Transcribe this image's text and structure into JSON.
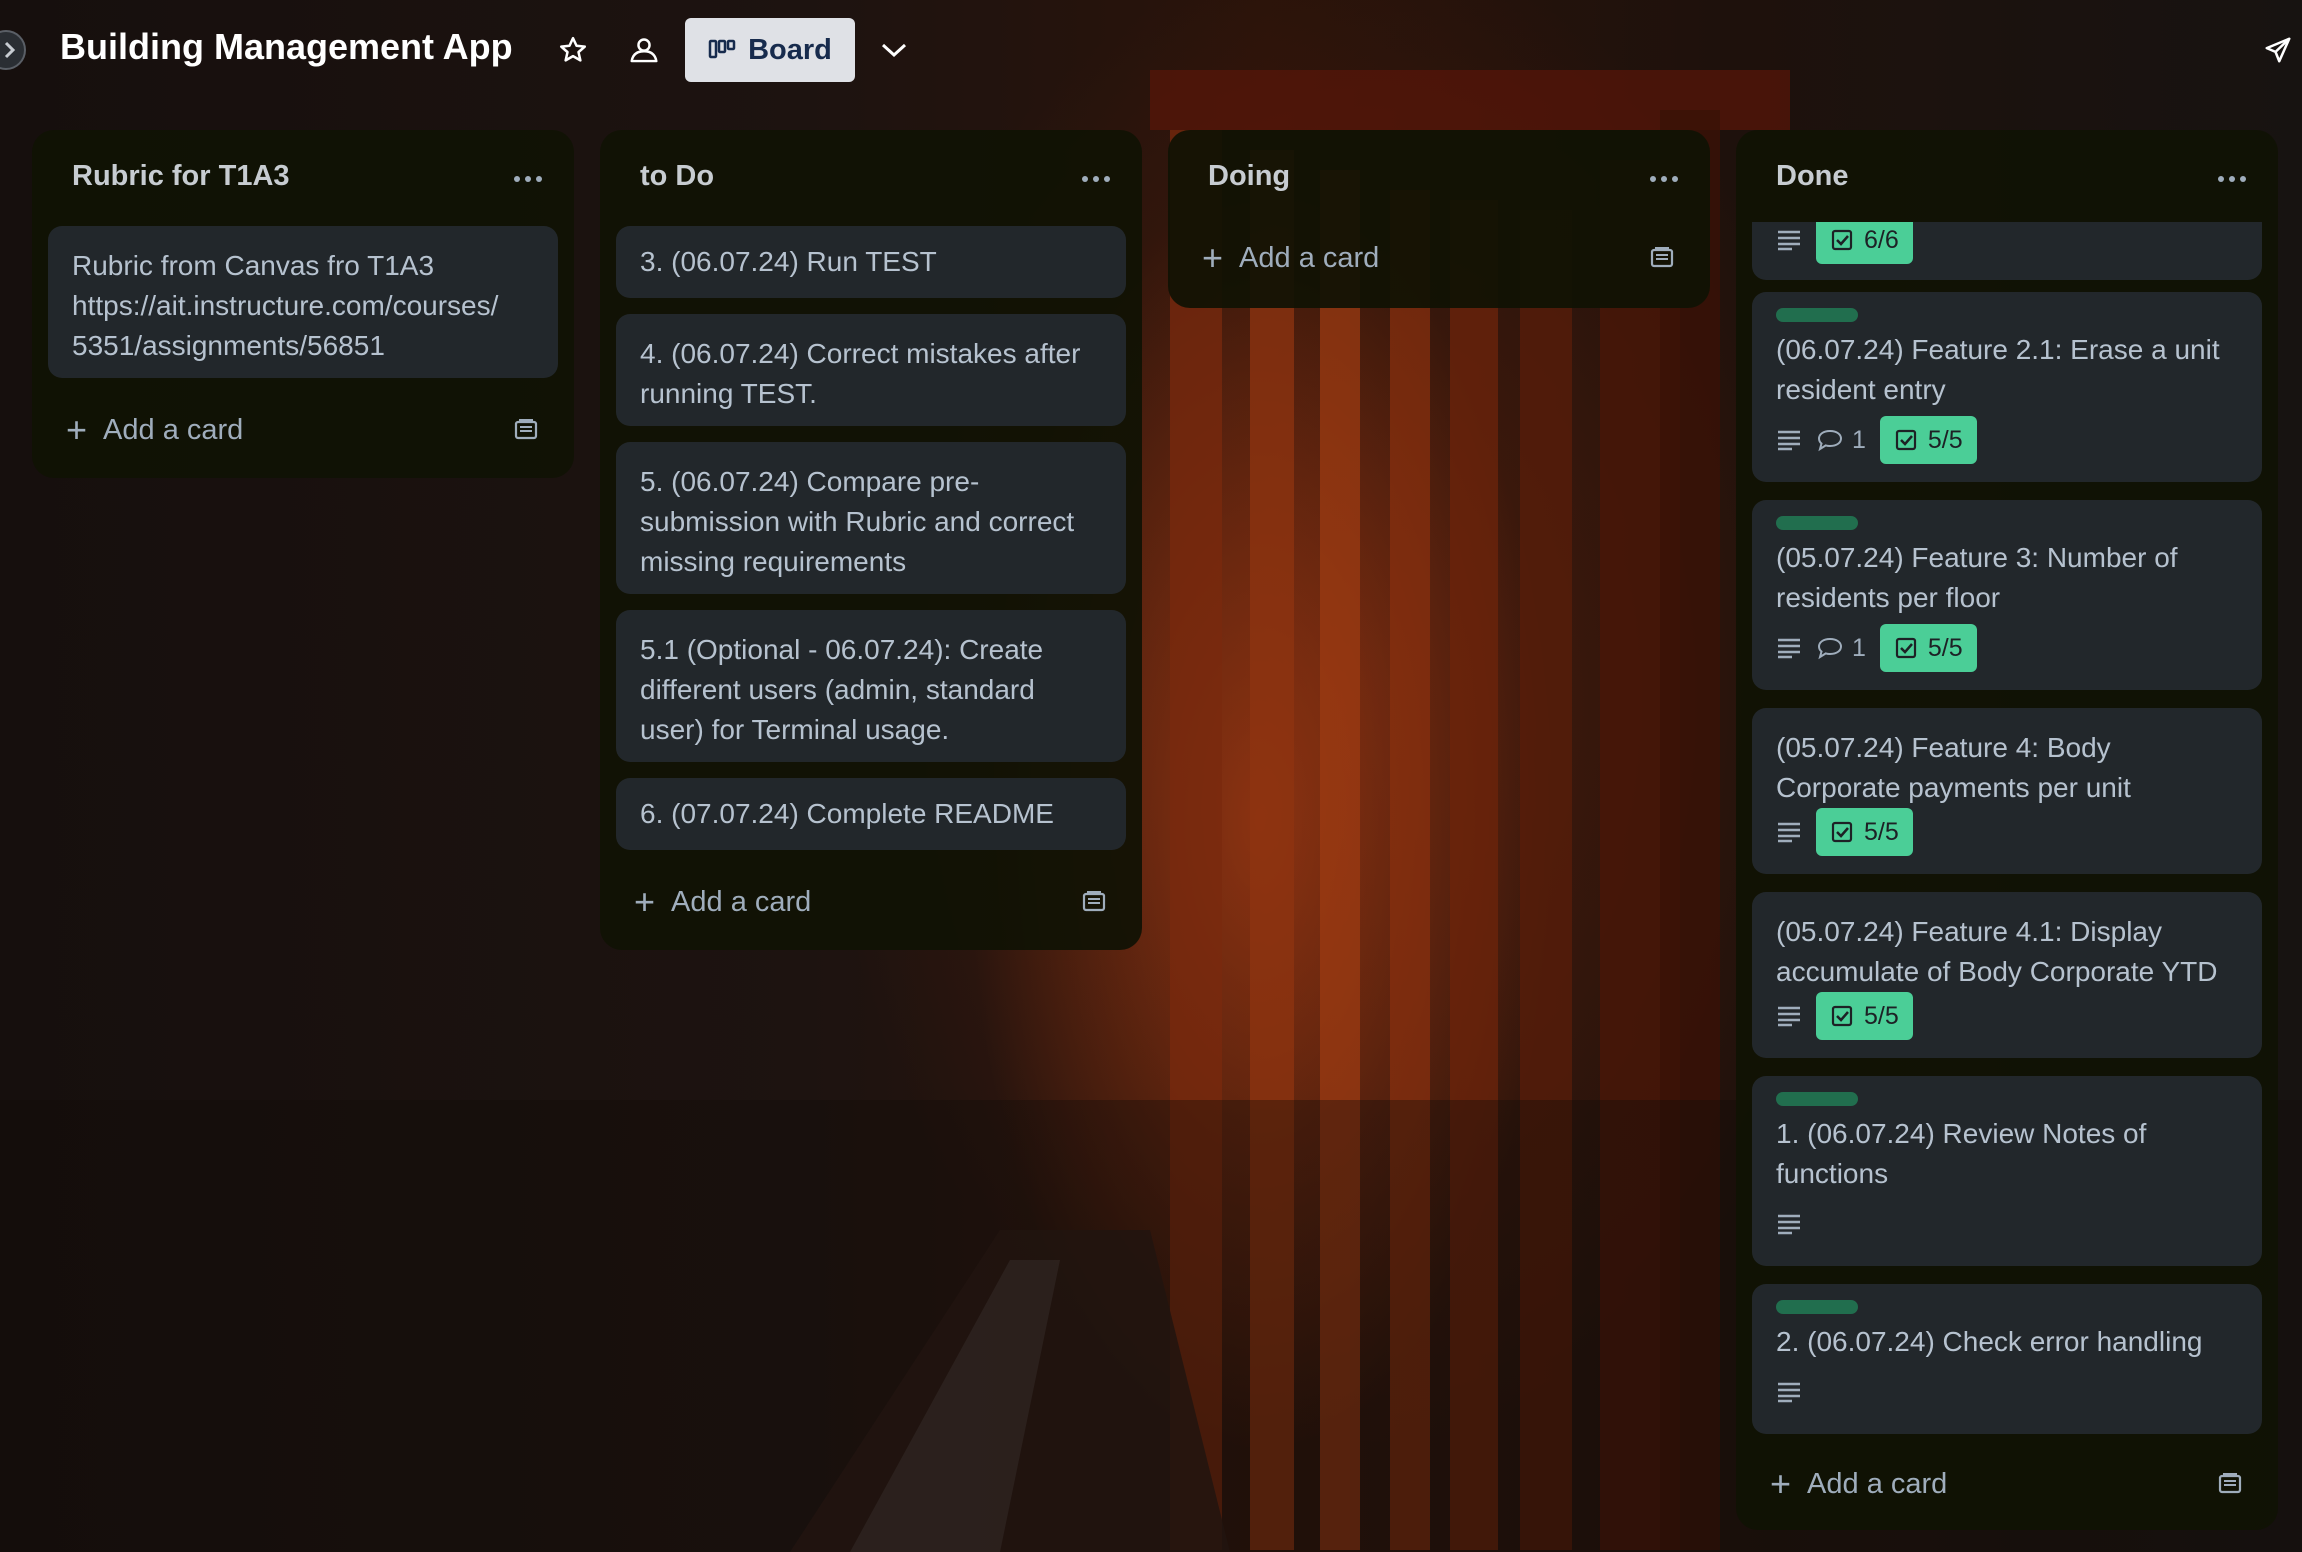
{
  "board": {
    "title": "Building Management App",
    "view_label": "Board"
  },
  "header_icons": [
    "chevron-right-icon",
    "star-icon",
    "team-visibility-icon",
    "board-icon",
    "chevron-down-icon",
    "power-up-rocket-icon"
  ],
  "lists": {
    "rubric": {
      "name": "Rubric for T1A3",
      "cards": [
        {
          "lines": [
            "Rubric from Canvas fro T1A3",
            "https://ait.instructure.com/courses/",
            "5351/assignments/56851"
          ]
        }
      ],
      "add_card": "Add a card"
    },
    "todo": {
      "name": "to Do",
      "cards": [
        {
          "lines": [
            "3. (06.07.24) Run TEST"
          ]
        },
        {
          "lines": [
            "4. (06.07.24) Correct mistakes after",
            "running TEST."
          ]
        },
        {
          "lines": [
            "5. (06.07.24) Compare pre-",
            "submission with Rubric and correct",
            "missing requirements"
          ]
        },
        {
          "lines": [
            "5.1 (Optional - 06.07.24): Create",
            "different users (admin, standard",
            "user) for Terminal usage."
          ]
        },
        {
          "lines": [
            "6. (07.07.24) Complete README"
          ]
        }
      ],
      "add_card": "Add a card"
    },
    "doing": {
      "name": "Doing",
      "add_card": "Add a card"
    },
    "done": {
      "name": "Done",
      "cards": [
        {
          "checklist": "6/6"
        },
        {
          "lines": [
            "(06.07.24) Feature 2.1: Erase a unit",
            "resident entry"
          ],
          "comments": "1",
          "checklist": "5/5"
        },
        {
          "lines": [
            "(05.07.24) Feature 3: Number of",
            "residents per floor"
          ],
          "comments": "1",
          "checklist": "5/5"
        },
        {
          "lines": [
            "(05.07.24) Feature 4: Body",
            "Corporate payments per unit"
          ],
          "checklist": "5/5"
        },
        {
          "lines": [
            "(05.07.24) Feature 4.1: Display",
            "accumulate of Body Corporate YTD"
          ],
          "checklist": "5/5"
        },
        {
          "lines": [
            "1. (06.07.24) Review Notes of",
            "functions"
          ]
        },
        {
          "lines": [
            "2. (06.07.24) Check error handling"
          ]
        }
      ],
      "add_card": "Add a card"
    }
  },
  "colors": {
    "list_bg": "#101204",
    "card_bg": "#22272b",
    "label_green": "#216e4e",
    "checklist_complete": "#4bce97"
  }
}
